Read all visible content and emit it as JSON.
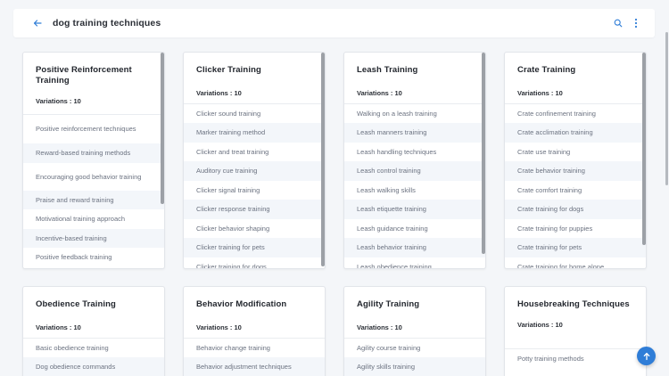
{
  "header": {
    "title": "dog training techniques",
    "accent": "#2f7dd7"
  },
  "cards": [
    {
      "title": "Positive Reinforcement Training",
      "variations": "Variations : 10",
      "items": [
        "Positive reinforcement techniques",
        "Reward-based training methods",
        "Encouraging good behavior training",
        "Praise and reward training",
        "Motivational training approach",
        "Incentive-based training",
        "Positive feedback training"
      ]
    },
    {
      "title": "Clicker Training",
      "variations": "Variations : 10",
      "items": [
        "Clicker sound training",
        "Marker training method",
        "Clicker and treat training",
        "Auditory cue training",
        "Clicker signal training",
        "Clicker response training",
        "Clicker behavior shaping",
        "Clicker training for pets",
        "Clicker training for dogs"
      ]
    },
    {
      "title": "Leash Training",
      "variations": "Variations : 10",
      "items": [
        "Walking on a leash training",
        "Leash manners training",
        "Leash handling techniques",
        "Leash control training",
        "Leash walking skills",
        "Leash etiquette training",
        "Leash guidance training",
        "Leash behavior training",
        "Leash obedience training"
      ]
    },
    {
      "title": "Crate Training",
      "variations": "Variations : 10",
      "items": [
        "Crate confinement training",
        "Crate acclimation training",
        "Crate use training",
        "Crate behavior training",
        "Crate comfort training",
        "Crate training for dogs",
        "Crate training for puppies",
        "Crate training for pets",
        "Crate training for home alone"
      ]
    },
    {
      "title": "Obedience Training",
      "variations": "Variations : 10",
      "items": [
        "Basic obedience training",
        "Dog obedience commands"
      ]
    },
    {
      "title": "Behavior Modification",
      "variations": "Variations : 10",
      "items": [
        "Behavior change training",
        "Behavior adjustment techniques"
      ]
    },
    {
      "title": "Agility Training",
      "variations": "Variations : 10",
      "items": [
        "Agility course training",
        "Agility skills training"
      ]
    },
    {
      "title": "Housebreaking Techniques",
      "variations": "Variations : 10",
      "items": [
        "Potty training methods"
      ]
    }
  ]
}
